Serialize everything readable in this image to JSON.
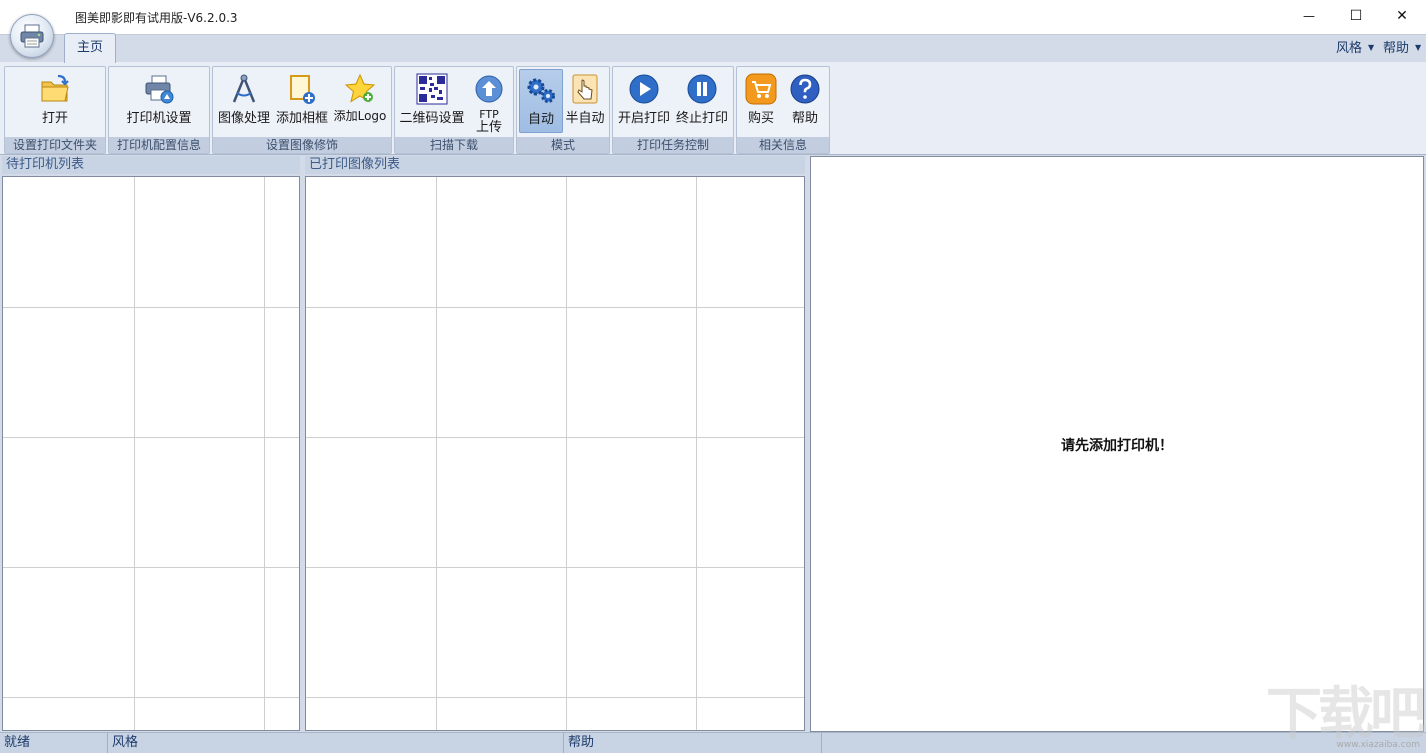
{
  "window": {
    "title": "图美即影即有试用版-V6.2.0.3",
    "minimize_glyph": "—",
    "maximize_glyph": "☐",
    "close_glyph": "✕"
  },
  "tabs": {
    "home": "主页"
  },
  "top_menu": {
    "style": "风格",
    "help": "帮助",
    "caret": "▼"
  },
  "ribbon": {
    "groups": [
      {
        "caption": "设置打印文件夹",
        "buttons": [
          {
            "label": "打开",
            "icon": "folder-open-icon"
          }
        ]
      },
      {
        "caption": "打印机配置信息",
        "buttons": [
          {
            "label": "打印机设置",
            "icon": "printer-settings-icon"
          }
        ]
      },
      {
        "caption": "设置图像修饰",
        "buttons": [
          {
            "label": "图像处理",
            "icon": "drafting-compass-icon"
          },
          {
            "label": "添加相框",
            "icon": "add-frame-icon"
          },
          {
            "label": "添加Logo",
            "icon": "star-icon"
          }
        ]
      },
      {
        "caption": "扫描下载",
        "buttons": [
          {
            "label": "二维码设置",
            "icon": "qr-code-icon"
          },
          {
            "label": "FTP",
            "label2": "上传",
            "icon": "upload-arrow-icon"
          }
        ]
      },
      {
        "caption": "模式",
        "buttons": [
          {
            "label": "自动",
            "icon": "gears-icon",
            "active": true
          },
          {
            "label": "半自动",
            "icon": "hand-pointer-icon"
          }
        ]
      },
      {
        "caption": "打印任务控制",
        "buttons": [
          {
            "label": "开启打印",
            "icon": "play-icon"
          },
          {
            "label": "终止打印",
            "icon": "pause-icon"
          }
        ]
      },
      {
        "caption": "相关信息",
        "buttons": [
          {
            "label": "购买",
            "icon": "shopping-cart-icon"
          },
          {
            "label": "帮助",
            "icon": "help-icon"
          }
        ]
      }
    ]
  },
  "panels": {
    "printer_list": {
      "header": "待打印机列表"
    },
    "printed_list": {
      "header": "已打印图像列表"
    },
    "preview": {
      "message": "请先添加打印机！"
    }
  },
  "statusbar": {
    "ready": "就绪",
    "style": "风格",
    "help": "帮助"
  },
  "watermark": {
    "text": "下载吧",
    "small": "www.xiazaiba.com"
  },
  "colors": {
    "accent": "#1d3b6b",
    "ribbon_bg": "#e9eef6",
    "caption_bg": "#c2cee0",
    "active_button": "#9fbde3"
  }
}
